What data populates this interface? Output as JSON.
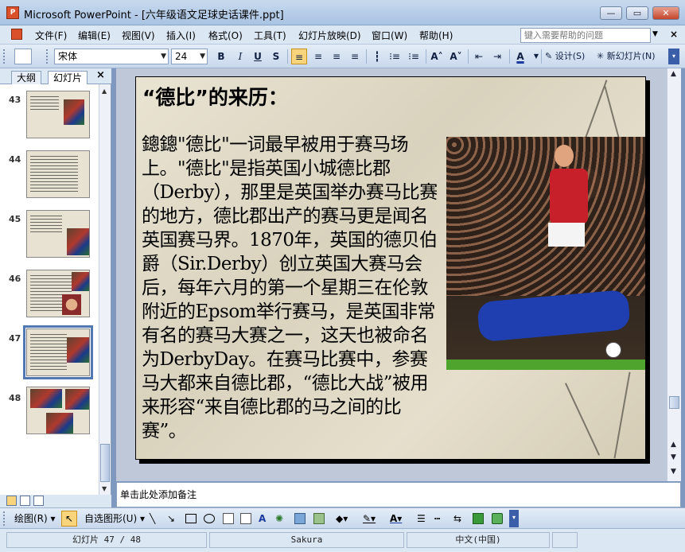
{
  "window": {
    "app_icon_text": "P",
    "title": "Microsoft PowerPoint - [六年级语文足球史话课件.ppt]",
    "min": "—",
    "max": "▭",
    "close": "✕"
  },
  "menu": {
    "items": [
      "文件(F)",
      "编辑(E)",
      "视图(V)",
      "插入(I)",
      "格式(O)",
      "工具(T)",
      "幻灯片放映(D)",
      "窗口(W)",
      "帮助(H)"
    ],
    "help_placeholder": "键入需要帮助的问题",
    "close_doc": "×"
  },
  "toolbar": {
    "font_name": "宋体",
    "font_size": "24",
    "bold": "B",
    "italic": "I",
    "underline": "U",
    "shadow": "S",
    "align_left": "≡",
    "align_center": "≡",
    "align_right": "≡",
    "justify": "≡",
    "numbering": "⁝≡",
    "bullets": "⁝≡",
    "grow_font": "A˄",
    "shrink_font": "A˅",
    "decrease_indent": "⇤",
    "increase_indent": "⇥",
    "font_color": "A",
    "design": "设计(S)",
    "new_slide": "新幻灯片(N)"
  },
  "left_panel": {
    "tab_outline": "大纲",
    "tab_slides": "幻灯片",
    "close": "×",
    "thumbnails": [
      {
        "num": "43"
      },
      {
        "num": "44"
      },
      {
        "num": "45"
      },
      {
        "num": "46"
      },
      {
        "num": "47",
        "selected": true
      },
      {
        "num": "48"
      }
    ]
  },
  "slide": {
    "title": "“德比”的来历：",
    "body": "鏓鏓\"德比\"一词最早被用于赛马场上。\"德比\"是指英国小城德比郡（Derby），那里是英国举办赛马比赛的地方，德比郡出产的赛马更是闻名英国赛马界。1870年，英国的德贝伯爵（Sir.Derby）创立英国大赛马会后，每年六月的第一个星期三在伦敦附近的Epsom举行赛马，是英国非常有名的赛马大赛之一，这天也被命名为DerbyDay。在赛马比赛中，参赛马大都来自德比郡，“德比大战”被用来形容“来自德比郡的马之间的比赛”。"
  },
  "notes": {
    "placeholder": "单击此处添加备注"
  },
  "drawbar": {
    "draw": "绘图(R)",
    "autoshapes": "自选图形(U)"
  },
  "status": {
    "slide_count": "幻灯片 47 / 48",
    "template": "Sakura",
    "language": "中文(中国)"
  }
}
